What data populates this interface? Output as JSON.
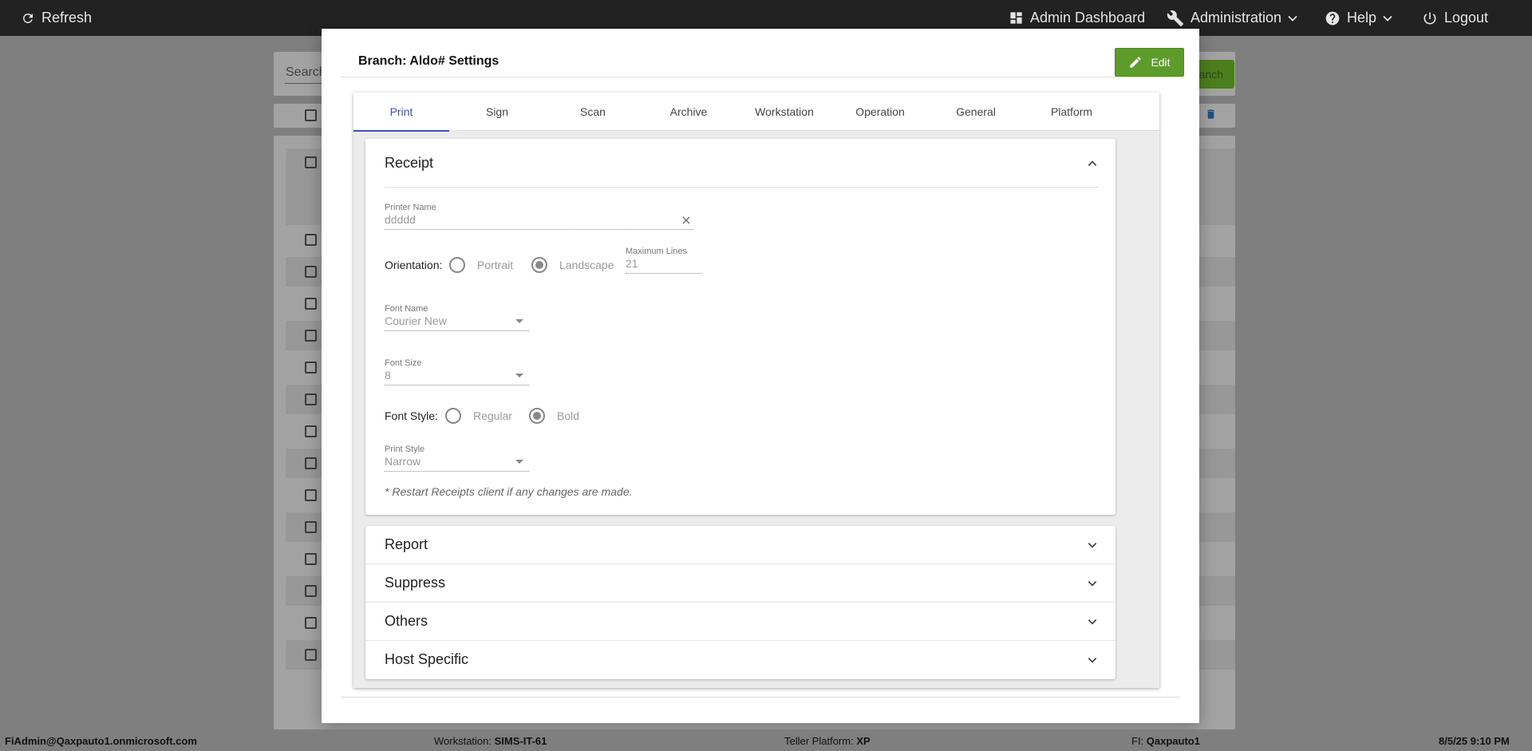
{
  "topbar": {
    "refresh": "Refresh",
    "admin_dashboard": "Admin Dashboard",
    "administration": "Administration",
    "help": "Help",
    "logout": "Logout"
  },
  "background": {
    "search_placeholder": "Search",
    "search_button": "anch"
  },
  "modal": {
    "title": "Branch: Aldo# Settings",
    "edit_label": "Edit",
    "tabs": [
      "Print",
      "Sign",
      "Scan",
      "Archive",
      "Workstation",
      "Operation",
      "General",
      "Platform"
    ],
    "active_tab": "Print",
    "receipt": {
      "title": "Receipt",
      "printer_name_label": "Printer Name",
      "printer_name_value": "ddddd",
      "orientation_label": "Orientation:",
      "orientation_options": [
        "Portrait",
        "Landscape"
      ],
      "orientation_selected": "Landscape",
      "max_lines_label": "Maximum Lines",
      "max_lines_value": "21",
      "font_name_label": "Font Name",
      "font_name_value": "Courier New",
      "font_size_label": "Font Size",
      "font_size_value": "8",
      "font_style_label": "Font Style:",
      "font_style_options": [
        "Regular",
        "Bold"
      ],
      "font_style_selected": "Bold",
      "print_style_label": "Print Style",
      "print_style_value": "Narrow",
      "note": "* Restart Receipts client if any changes are made."
    },
    "sections": [
      "Report",
      "Suppress",
      "Others",
      "Host Specific"
    ]
  },
  "statusbar": {
    "user": "FiAdmin@Qaxpauto1.onmicrosoft.com",
    "workstation_label": "Workstation:",
    "workstation_value": "SIMS-IT-61",
    "platform_label": "Teller Platform:",
    "platform_value": "XP",
    "fi_label": "FI:",
    "fi_value": "Qaxpauto1",
    "datetime": "8/5/25 9:10 PM"
  },
  "colors": {
    "accent_tab": "#3f51b5",
    "edit_button": "#5d9b2a",
    "topbar": "#222222"
  }
}
